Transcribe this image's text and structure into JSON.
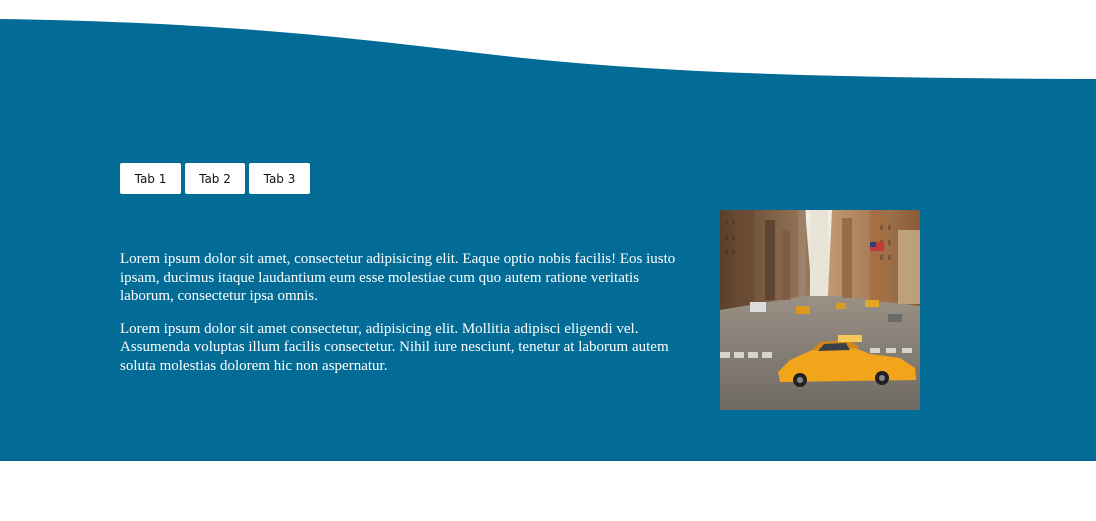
{
  "colors": {
    "band": "#026b96",
    "background": "#ffffff",
    "tab_bg": "#ffffff",
    "text": "#ffffff",
    "taxi": "#f2a51a"
  },
  "tabs": [
    {
      "label": "Tab 1"
    },
    {
      "label": "Tab 2"
    },
    {
      "label": "Tab 3"
    }
  ],
  "content": {
    "paragraphs": [
      "Lorem ipsum dolor sit amet, consectetur adipisicing elit. Eaque optio nobis facilis! Eos iusto ipsam, ducimus itaque laudantium eum esse molestiae cum quo autem ratione veritatis laborum, consectetur ipsa omnis.",
      "Lorem ipsum dolor sit amet consectetur, adipisicing elit. Mollitia adipisci eligendi vel. Assumenda voluptas illum facilis consectetur. Nihil iure nesciunt, tenetur at laborum autem soluta molestias dolorem hic non aspernatur."
    ]
  },
  "image": {
    "subject": "city-street-taxi-photo"
  }
}
